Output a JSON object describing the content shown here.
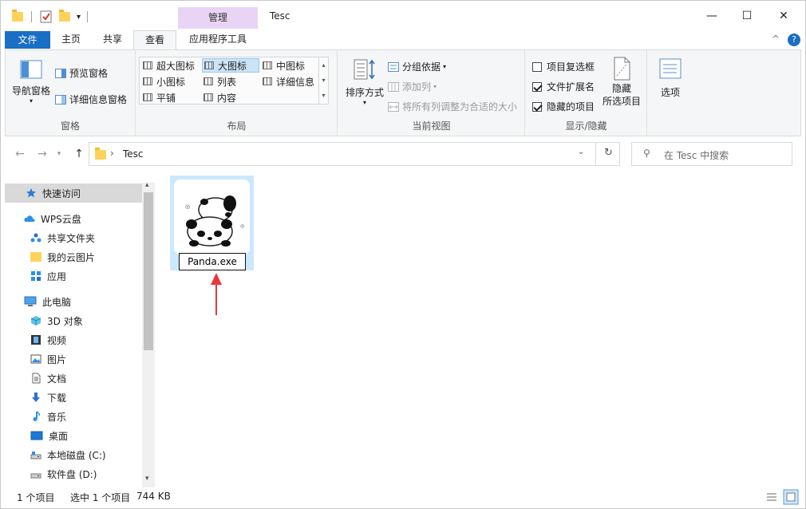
{
  "window": {
    "title": "Tesc",
    "context_tab": "管理",
    "minimize": "—",
    "maximize": "☐",
    "close": "✕"
  },
  "tabs": {
    "file": "文件",
    "home": "主页",
    "share": "共享",
    "view": "查看",
    "app_tools": "应用程序工具",
    "collapse": "^",
    "help": "?"
  },
  "ribbon": {
    "panes": {
      "nav_pane": "导航窗格",
      "preview_pane": "预览窗格",
      "details_pane": "详细信息窗格",
      "label": "窗格"
    },
    "layout": {
      "extra_large": "超大图标",
      "large": "大图标",
      "medium": "中图标",
      "small": "小图标",
      "list": "列表",
      "details": "详细信息",
      "tiles": "平铺",
      "content": "内容",
      "label": "布局"
    },
    "current_view": {
      "sort_by": "排序方式",
      "group_by": "分组依据",
      "add_columns": "添加列",
      "size_columns": "将所有列调整为合适的大小",
      "label": "当前视图"
    },
    "show_hide": {
      "item_checkboxes": "项目复选框",
      "file_extensions": "文件扩展名",
      "hidden_items": "隐藏的项目",
      "hide_selected_1": "隐藏",
      "hide_selected_2": "所选项目",
      "label": "显示/隐藏"
    },
    "options": "选项"
  },
  "address": {
    "path_item": "Tesc",
    "separator": "›",
    "search_placeholder": "在 Tesc 中搜索"
  },
  "sidebar": {
    "items": [
      {
        "label": "快速访问"
      },
      {
        "label": "WPS云盘"
      },
      {
        "label": "共享文件夹"
      },
      {
        "label": "我的云图片"
      },
      {
        "label": "应用"
      },
      {
        "label": "此电脑"
      },
      {
        "label": "3D 对象"
      },
      {
        "label": "视频"
      },
      {
        "label": "图片"
      },
      {
        "label": "文档"
      },
      {
        "label": "下载"
      },
      {
        "label": "音乐"
      },
      {
        "label": "桌面"
      },
      {
        "label": "本地磁盘 (C:)"
      },
      {
        "label": "软件盘 (D:)"
      }
    ]
  },
  "file": {
    "name_value": "Panda.exe"
  },
  "status": {
    "item_count": "1 个项目",
    "selected": "选中 1 个项目",
    "size": "744 KB"
  },
  "colors": {
    "file_tab": "#1a6fc4",
    "context_tab": "#e9d4f5",
    "selection": "#cce8ff",
    "arrow": "#e8383d"
  }
}
